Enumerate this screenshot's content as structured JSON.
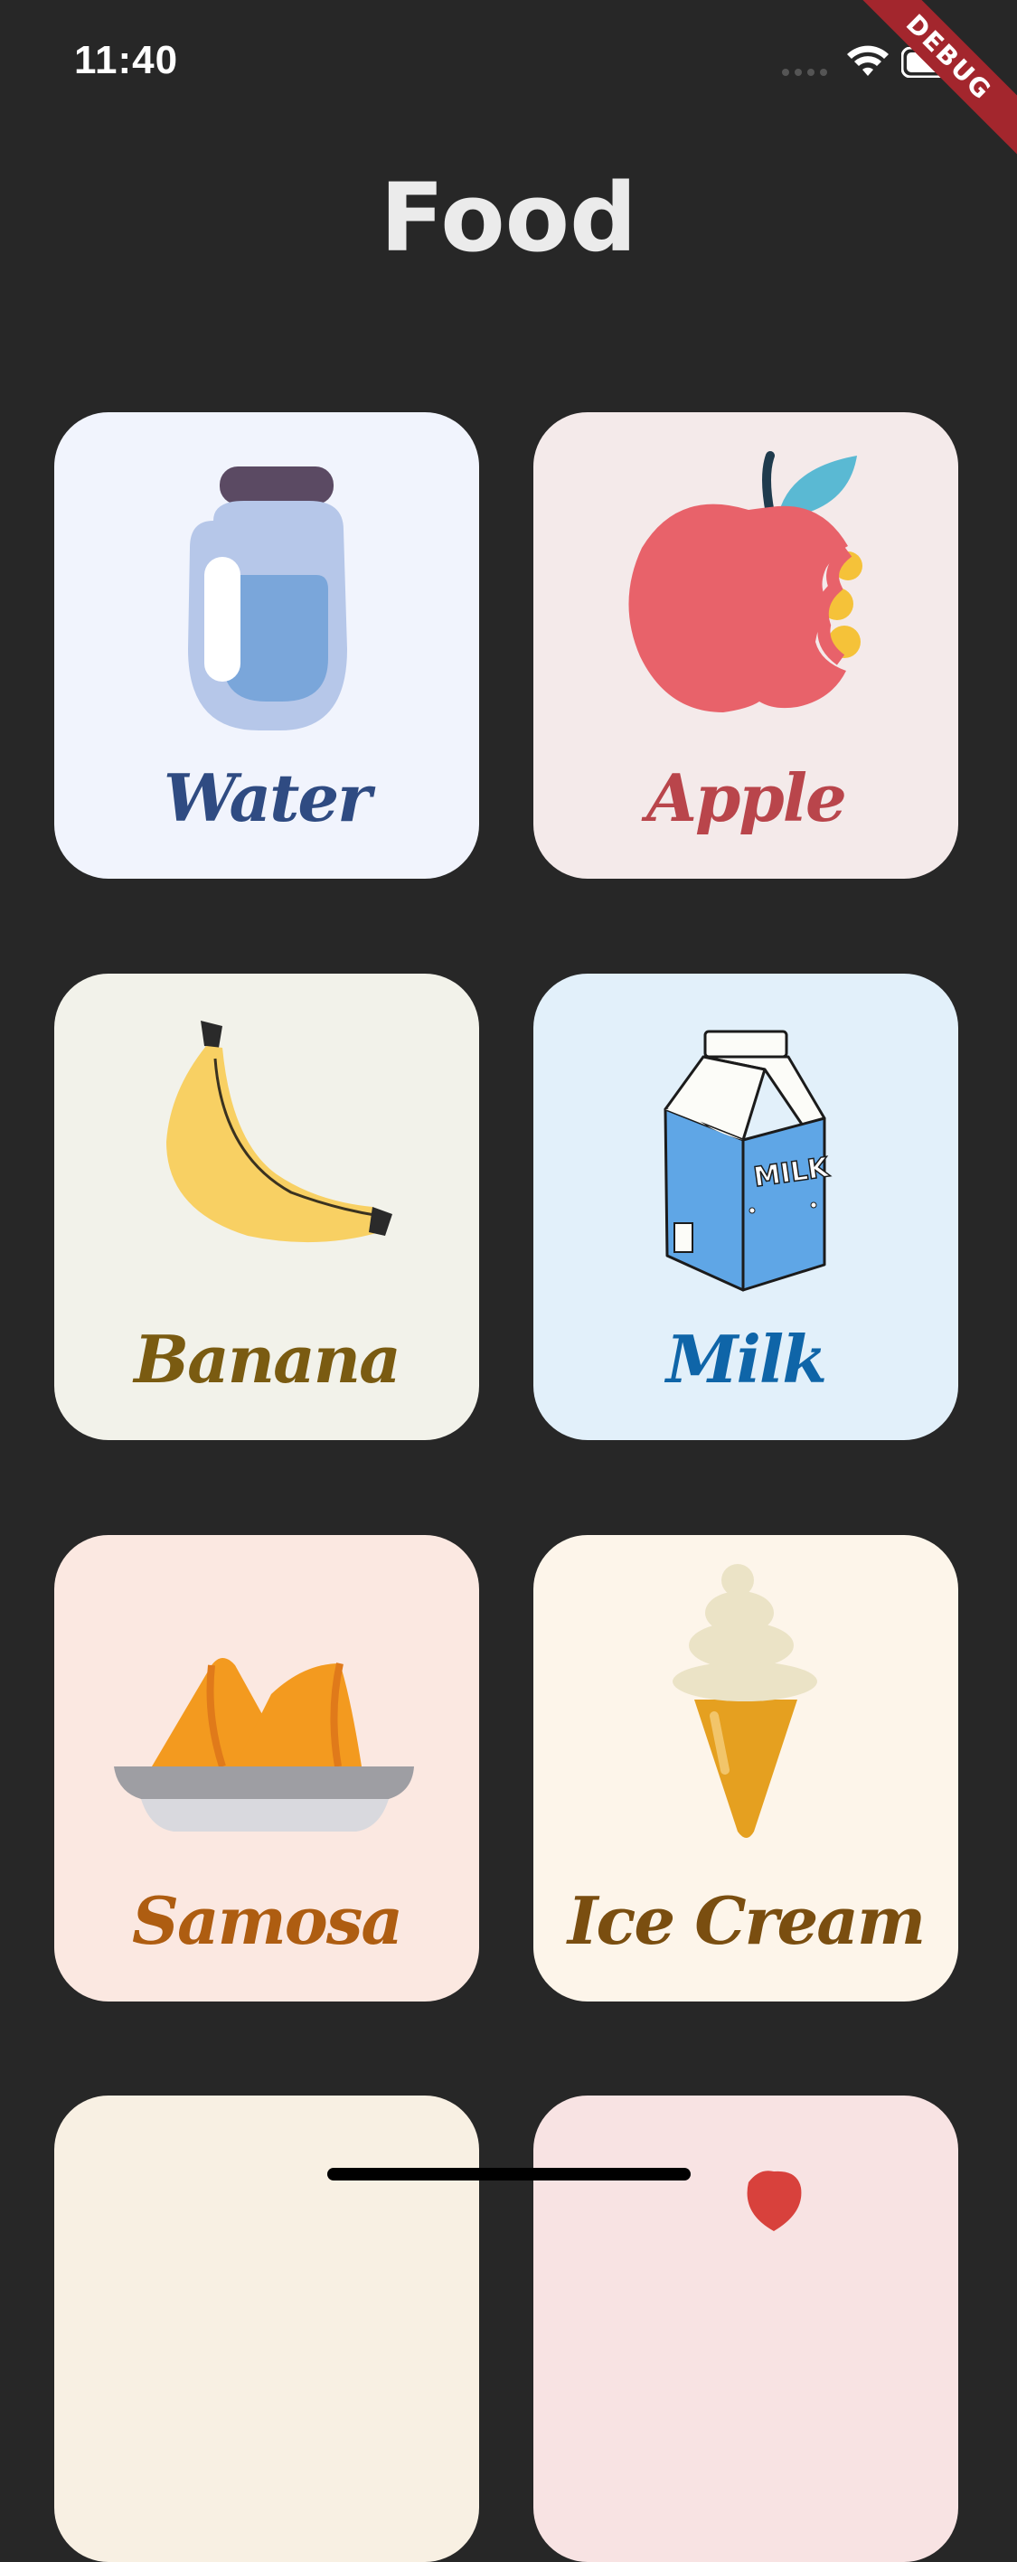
{
  "status_bar": {
    "time": "11:40"
  },
  "debug_banner": "DEBUG",
  "page": {
    "title": "Food"
  },
  "items": [
    {
      "label": "Water",
      "bg": "#f1f4fd",
      "color": "#2f4b82"
    },
    {
      "label": "Apple",
      "bg": "#f4eaea",
      "color": "#b9454b"
    },
    {
      "label": "Banana",
      "bg": "#f2f2ea",
      "color": "#7a5b11"
    },
    {
      "label": "Milk",
      "bg": "#e2f0fa",
      "color": "#0f65a8"
    },
    {
      "label": "Samosa",
      "bg": "#fbe8e1",
      "color": "#ae5d11"
    },
    {
      "label": "Ice Cream",
      "bg": "#fdf5ea",
      "color": "#7a4e10"
    },
    {
      "label": "",
      "bg": "#f8f0e3",
      "color": "#7a4e10"
    },
    {
      "label": "",
      "bg": "#f8e3e3",
      "color": "#b9454b"
    }
  ]
}
